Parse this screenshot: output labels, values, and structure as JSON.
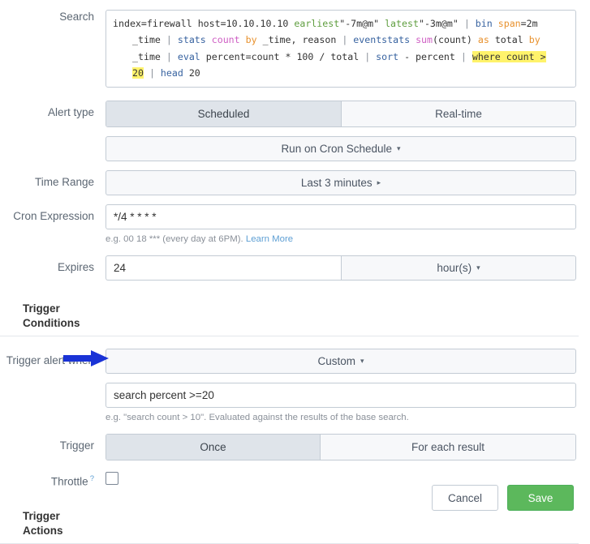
{
  "labels": {
    "search": "Search",
    "alert_type": "Alert type",
    "time_range": "Time Range",
    "cron_expression": "Cron Expression",
    "expires": "Expires",
    "trigger_conditions": "Trigger Conditions",
    "trigger_alert_when": "Trigger alert when",
    "trigger": "Trigger",
    "throttle": "Throttle",
    "throttle_help": "?",
    "trigger_actions": "Trigger Actions"
  },
  "search_query": {
    "line1": {
      "a": "index=firewall host=10.10.10.10 ",
      "earliest_kw": "earliest",
      "earliest_val": "\"-7m@m\"",
      "space1": " ",
      "latest_kw": "latest",
      "latest_val": "\"-3m@m\"",
      "pipe1": " | ",
      "bin": "bin",
      "span": " span",
      "span_val": "=2m"
    },
    "line2": {
      "time": "_time ",
      "pipe": "| ",
      "stats": "stats",
      "count": " count",
      "by": " by",
      "rest": " _time, reason ",
      "pipe2": "| ",
      "eventstats": "eventstats",
      "sum": " sum",
      "sum_args": "(count)",
      "as": " as",
      "total": " total",
      "by2": " by"
    },
    "line3": {
      "time": "_time ",
      "pipe": "| ",
      "eval": "eval",
      "expr": " percent=count * 100 / total ",
      "pipe2": "| ",
      "sort": "sort",
      "sort_arg": " - percent ",
      "pipe3": "| ",
      "where_hl": "where count >"
    },
    "line4": {
      "twenty_hl": "20",
      "pipe": " | ",
      "head": "head",
      "head_arg": " 20"
    },
    "plain_text": "index=firewall host=10.10.10.10 earliest=\"-7m@m\" latest=\"-3m@m\" | bin span=2m _time | stats count by _time, reason | eventstats sum(count) as total by _time | eval percent=count * 100 / total | sort - percent | where count > 20 | head 20"
  },
  "alert_type": {
    "options": [
      "Scheduled",
      "Real-time"
    ],
    "selected": "Scheduled"
  },
  "schedule": {
    "label": "Run on Cron Schedule",
    "caret": "▾"
  },
  "time_range": {
    "value": "Last 3 minutes",
    "caret": "▸"
  },
  "cron": {
    "value": "*/4 * * * *",
    "hint_prefix": "e.g. 00 18 *** (every day at 6PM). ",
    "hint_link": "Learn More"
  },
  "expires": {
    "value": "24",
    "unit": "hour(s)",
    "caret": "▾"
  },
  "trigger_alert_when": {
    "value": "Custom",
    "caret": "▾"
  },
  "condition": {
    "value": "search percent >=20",
    "hint": "e.g. \"search count > 10\". Evaluated against the results of the base search."
  },
  "trigger": {
    "options": [
      "Once",
      "For each result"
    ],
    "selected": "Once"
  },
  "throttle": {
    "checked": false
  },
  "footer": {
    "cancel": "Cancel",
    "save": "Save"
  },
  "annotation": {
    "type": "arrow",
    "color": "#1a33d6",
    "points_to": "condition-input"
  },
  "colors": {
    "accent_save": "#5cb85c",
    "link": "#5e9fd4",
    "highlight": "#fff36b",
    "arrow": "#1a33d6",
    "tab_active": "#dfe4ea",
    "border": "#c3cbd4"
  }
}
